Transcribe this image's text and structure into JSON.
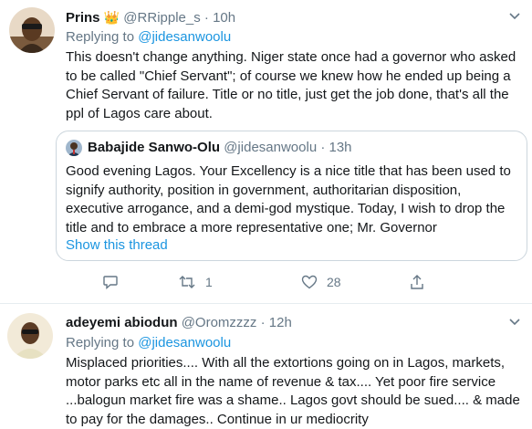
{
  "tweets": [
    {
      "display_name": "Prins",
      "handle": "@RRipple_s",
      "time": "· 10h",
      "replying_label": "Replying to",
      "replying_handle": "@jidesanwoolu",
      "text": "This doesn't change anything. Niger state once had a governor who asked to be called \"Chief Servant\"; of course we knew how he ended up being a Chief Servant of failure. Title or no title, just get the job done, that's all the ppl of Lagos care about.",
      "quote": {
        "display_name": "Babajide Sanwo-Olu",
        "handle": "@jidesanwoolu",
        "time": "· 13h",
        "text": "Good evening Lagos. Your Excellency is a nice title that has been used to signify authority, position in government, authoritarian disposition, executive arrogance, and a demi-god mystique. Today, I wish to drop the title and to embrace a more representative one; Mr. Governor",
        "show_thread": "Show this thread"
      },
      "retweet_count": "1",
      "like_count": "28"
    },
    {
      "display_name": "adeyemi abiodun",
      "handle": "@Oromzzzz",
      "time": "· 12h",
      "replying_label": "Replying to",
      "replying_handle": "@jidesanwoolu",
      "text": "Misplaced priorities.... With all the extortions going on in Lagos, markets, motor parks etc all in the name of revenue & tax.... Yet poor fire service ...balogun market fire was a shame.. Lagos govt should be sued.... & made to pay for the damages.. Continue  in ur mediocrity"
    }
  ],
  "colors": {
    "link": "#1b95e0",
    "muted": "#657786",
    "border": "#ccd6dd",
    "divider": "#e6ecf0"
  }
}
